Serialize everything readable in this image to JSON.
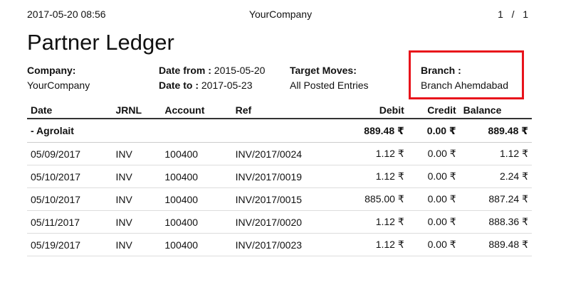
{
  "header": {
    "datetime": "2017-05-20 08:56",
    "company": "YourCompany",
    "page_current": "1",
    "page_sep": "/",
    "page_total": "1"
  },
  "title": "Partner Ledger",
  "info": {
    "company_label": "Company:",
    "company_value": "YourCompany",
    "date_from_label": "Date from :",
    "date_from_value": "2015-05-20",
    "date_to_label": "Date to :",
    "date_to_value": "2017-05-23",
    "target_moves_label": "Target Moves:",
    "target_moves_value": "All Posted Entries",
    "branch_label": "Branch :",
    "branch_value": "Branch Ahemdabad"
  },
  "colors": {
    "highlight_border": "#e8131b"
  },
  "table": {
    "columns": [
      "Date",
      "JRNL",
      "Account",
      "Ref",
      "Debit",
      "Credit",
      "Balance"
    ],
    "group": {
      "name": "- Agrolait",
      "debit": "889.48 ₹",
      "credit": "0.00 ₹",
      "balance": "889.48 ₹"
    },
    "rows": [
      {
        "date": "05/09/2017",
        "jrnl": "INV",
        "account": "100400",
        "ref": "INV/2017/0024",
        "debit": "1.12 ₹",
        "credit": "0.00 ₹",
        "balance": "1.12 ₹"
      },
      {
        "date": "05/10/2017",
        "jrnl": "INV",
        "account": "100400",
        "ref": "INV/2017/0019",
        "debit": "1.12 ₹",
        "credit": "0.00 ₹",
        "balance": "2.24 ₹"
      },
      {
        "date": "05/10/2017",
        "jrnl": "INV",
        "account": "100400",
        "ref": "INV/2017/0015",
        "debit": "885.00 ₹",
        "credit": "0.00 ₹",
        "balance": "887.24 ₹"
      },
      {
        "date": "05/11/2017",
        "jrnl": "INV",
        "account": "100400",
        "ref": "INV/2017/0020",
        "debit": "1.12 ₹",
        "credit": "0.00 ₹",
        "balance": "888.36 ₹"
      },
      {
        "date": "05/19/2017",
        "jrnl": "INV",
        "account": "100400",
        "ref": "INV/2017/0023",
        "debit": "1.12 ₹",
        "credit": "0.00 ₹",
        "balance": "889.48 ₹"
      }
    ]
  }
}
